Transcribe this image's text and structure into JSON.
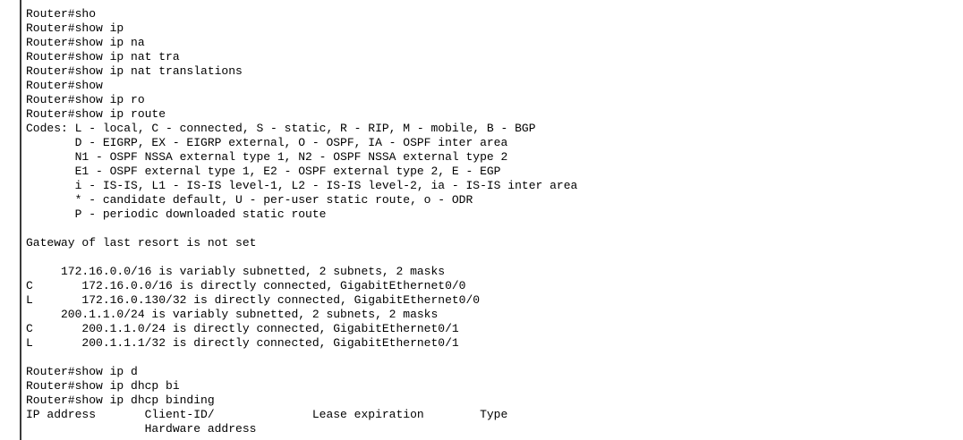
{
  "terminal": {
    "lines": [
      "Router#sho",
      "Router#show ip",
      "Router#show ip na",
      "Router#show ip nat tra",
      "Router#show ip nat translations",
      "Router#show",
      "Router#show ip ro",
      "Router#show ip route",
      "Codes: L - local, C - connected, S - static, R - RIP, M - mobile, B - BGP",
      "       D - EIGRP, EX - EIGRP external, O - OSPF, IA - OSPF inter area",
      "       N1 - OSPF NSSA external type 1, N2 - OSPF NSSA external type 2",
      "       E1 - OSPF external type 1, E2 - OSPF external type 2, E - EGP",
      "       i - IS-IS, L1 - IS-IS level-1, L2 - IS-IS level-2, ia - IS-IS inter area",
      "       * - candidate default, U - per-user static route, o - ODR",
      "       P - periodic downloaded static route",
      "",
      "Gateway of last resort is not set",
      "",
      "     172.16.0.0/16 is variably subnetted, 2 subnets, 2 masks",
      "C       172.16.0.0/16 is directly connected, GigabitEthernet0/0",
      "L       172.16.0.130/32 is directly connected, GigabitEthernet0/0",
      "     200.1.1.0/24 is variably subnetted, 2 subnets, 2 masks",
      "C       200.1.1.0/24 is directly connected, GigabitEthernet0/1",
      "L       200.1.1.1/32 is directly connected, GigabitEthernet0/1",
      "",
      "Router#show ip d",
      "Router#show ip dhcp bi",
      "Router#show ip dhcp binding",
      "IP address       Client-ID/              Lease expiration        Type",
      "                 Hardware address"
    ]
  }
}
